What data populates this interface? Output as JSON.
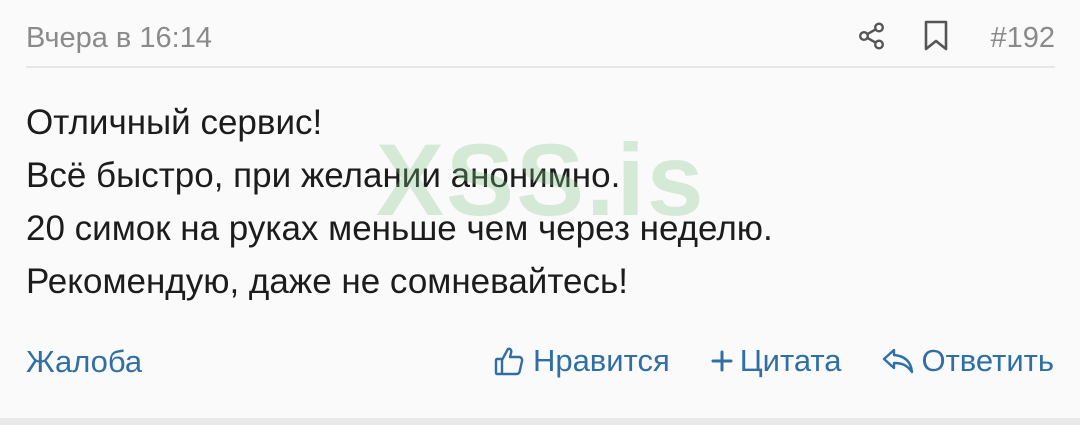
{
  "post": {
    "timestamp": "Вчера в 16:14",
    "number": "#192",
    "message_lines": [
      "Отличный сервис!",
      "Всё быстро, при желании анонимно.",
      "20 симок на руках меньше чем через неделю.",
      "Рекомендую, даже не сомневайтесь!"
    ],
    "watermark": "XSS.is"
  },
  "header_icons": {
    "share": "share-icon",
    "bookmark": "bookmark-icon"
  },
  "footer": {
    "report_label": "Жалоба",
    "like_label": "Нравится",
    "quote_label": "Цитата",
    "reply_label": "Ответить"
  },
  "colors": {
    "link": "#2f6fa5",
    "muted_text": "#8a8a8a",
    "body_text": "#1c1c1c",
    "watermark": "#81c784",
    "background": "#fafafa"
  }
}
